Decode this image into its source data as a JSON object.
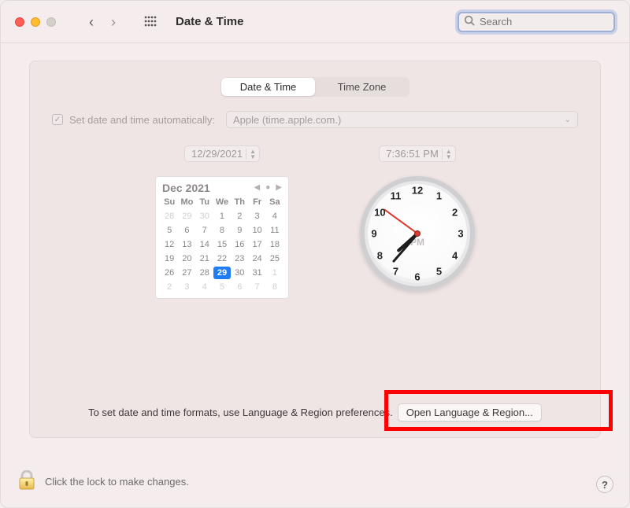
{
  "window": {
    "title": "Date & Time"
  },
  "search": {
    "placeholder": "Search"
  },
  "tabs": {
    "date_time": "Date & Time",
    "time_zone": "Time Zone"
  },
  "auto": {
    "label": "Set date and time automatically:",
    "server": "Apple (time.apple.com.)"
  },
  "date_stepper": "12/29/2021",
  "time_stepper": "7:36:51 PM",
  "calendar": {
    "title": "Dec 2021",
    "dow": [
      "Su",
      "Mo",
      "Tu",
      "We",
      "Th",
      "Fr",
      "Sa"
    ],
    "weeks": [
      [
        {
          "d": "28",
          "o": true
        },
        {
          "d": "29",
          "o": true
        },
        {
          "d": "30",
          "o": true
        },
        {
          "d": "1"
        },
        {
          "d": "2"
        },
        {
          "d": "3"
        },
        {
          "d": "4"
        }
      ],
      [
        {
          "d": "5"
        },
        {
          "d": "6"
        },
        {
          "d": "7"
        },
        {
          "d": "8"
        },
        {
          "d": "9"
        },
        {
          "d": "10"
        },
        {
          "d": "11"
        }
      ],
      [
        {
          "d": "12"
        },
        {
          "d": "13"
        },
        {
          "d": "14"
        },
        {
          "d": "15"
        },
        {
          "d": "16"
        },
        {
          "d": "17"
        },
        {
          "d": "18"
        }
      ],
      [
        {
          "d": "19"
        },
        {
          "d": "20"
        },
        {
          "d": "21"
        },
        {
          "d": "22"
        },
        {
          "d": "23"
        },
        {
          "d": "24"
        },
        {
          "d": "25"
        }
      ],
      [
        {
          "d": "26"
        },
        {
          "d": "27"
        },
        {
          "d": "28"
        },
        {
          "d": "29",
          "sel": true
        },
        {
          "d": "30"
        },
        {
          "d": "31"
        },
        {
          "d": "1",
          "o": true
        }
      ],
      [
        {
          "d": "2",
          "o": true
        },
        {
          "d": "3",
          "o": true
        },
        {
          "d": "4",
          "o": true
        },
        {
          "d": "5",
          "o": true
        },
        {
          "d": "6",
          "o": true
        },
        {
          "d": "7",
          "o": true
        },
        {
          "d": "8",
          "o": true
        }
      ]
    ]
  },
  "clock": {
    "numbers": [
      "12",
      "1",
      "2",
      "3",
      "4",
      "5",
      "6",
      "7",
      "8",
      "9",
      "10",
      "11"
    ],
    "ampm": "PM",
    "hour_angle": 228,
    "minute_angle": 221,
    "second_angle": 306
  },
  "bottom": {
    "hint": "To set date and time formats, use Language & Region preferences.",
    "button": "Open Language & Region..."
  },
  "lock": {
    "text": "Click the lock to make changes."
  },
  "help": "?"
}
